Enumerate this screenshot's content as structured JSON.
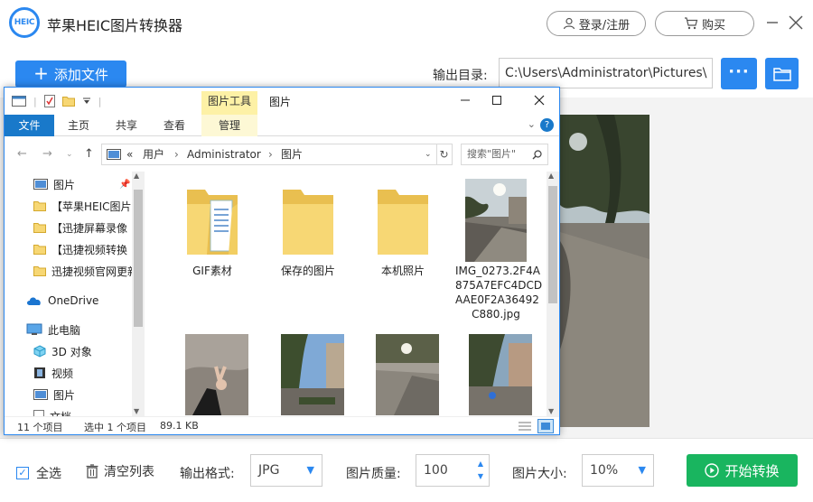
{
  "app": {
    "logo_text": "HEIC",
    "title": "苹果HEIC图片转换器",
    "login_label": "登录/注册",
    "buy_label": "购买",
    "add_file_label": "添加文件",
    "output_dir_label": "输出目录:",
    "output_dir_value": "C:\\Users\\Administrator\\Pictures\\",
    "more_label": "···",
    "accent_color": "#2b88f0",
    "start_color": "#19b55f"
  },
  "bottom": {
    "select_all_label": "全选",
    "clear_list_label": "清空列表",
    "format_label": "输出格式:",
    "format_value": "JPG",
    "quality_label": "图片质量:",
    "quality_value": "100",
    "size_label": "图片大小:",
    "size_value": "10%",
    "start_label": "开始转换"
  },
  "explorer": {
    "contextual_group": "图片工具",
    "window_title": "图片",
    "tabs": [
      "文件",
      "主页",
      "共享",
      "查看",
      "管理"
    ],
    "path": [
      "用户",
      "Administrator",
      "图片"
    ],
    "path_prefix": "«",
    "search_placeholder": "搜索\"图片\"",
    "nav_items": [
      "图片",
      "【苹果HEIC图片",
      "【迅捷屏幕录像",
      "【迅捷视频转换",
      "迅捷视频官网更新",
      "OneDrive",
      "此电脑",
      "3D 对象",
      "视频",
      "图片",
      "文档"
    ],
    "files": [
      {
        "name": "GIF素材",
        "icon": "folder-with-docs-icon"
      },
      {
        "name": "保存的图片",
        "icon": "folder-icon"
      },
      {
        "name": "本机照片",
        "icon": "folder-icon"
      },
      {
        "name": "IMG_0273.2F4A875A7EFC4DCDAAE0F2A36492C880.jpg",
        "name_lines": [
          "IMG_0273.2F4A",
          "875A7EFC4DCD",
          "AAE0F2A36492",
          "C880.jpg"
        ],
        "icon": "photo-thumbnail"
      }
    ],
    "status_count": "11 个项目",
    "status_selected": "选中 1 个项目",
    "status_size": "89.1 KB"
  }
}
